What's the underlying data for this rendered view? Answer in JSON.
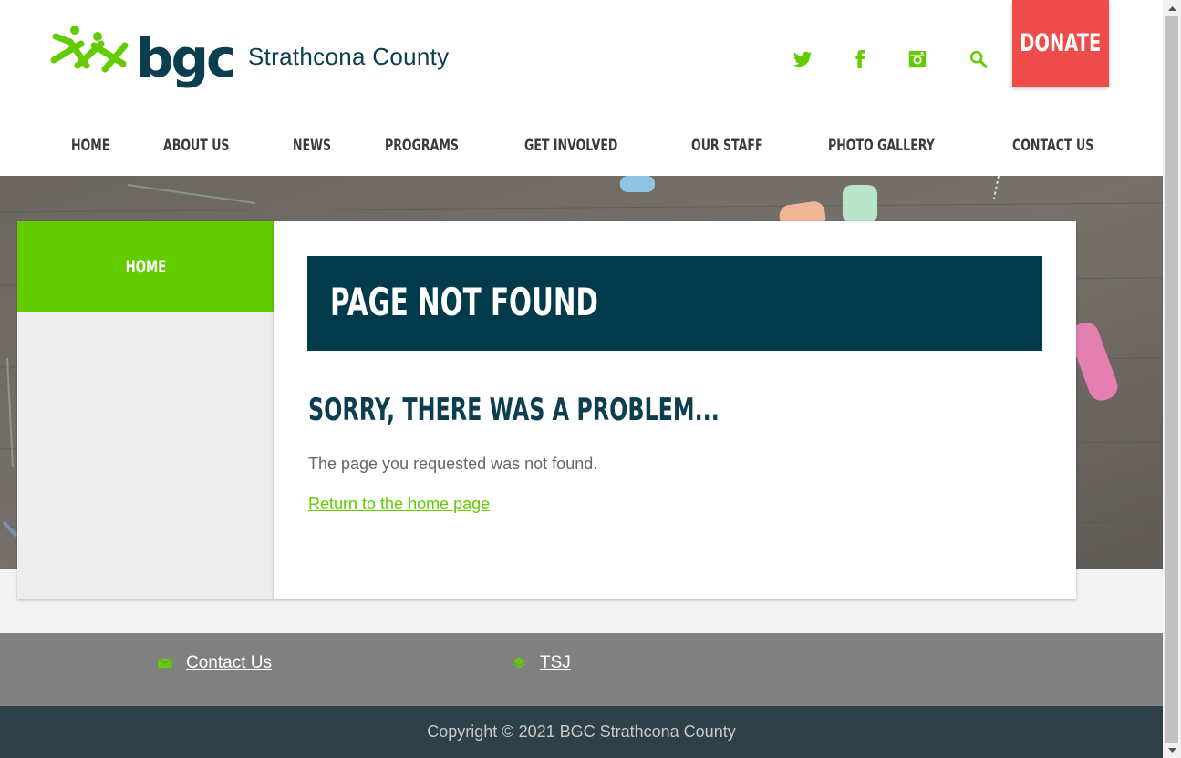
{
  "brand": {
    "logo_text": "bgc",
    "subtitle": "Strathcona County"
  },
  "header": {
    "social_icons": [
      "twitter-icon",
      "facebook-icon",
      "instagram-icon",
      "search-icon"
    ],
    "donate_label": "DONATE"
  },
  "nav": {
    "items": [
      {
        "label": "HOME"
      },
      {
        "label": "ABOUT US"
      },
      {
        "label": "NEWS"
      },
      {
        "label": "PROGRAMS"
      },
      {
        "label": "GET INVOLVED"
      },
      {
        "label": "OUR STAFF"
      },
      {
        "label": "PHOTO GALLERY"
      },
      {
        "label": "CONTACT US"
      }
    ]
  },
  "sidebar": {
    "home_label": "HOME"
  },
  "main": {
    "title": "PAGE NOT FOUND",
    "subheading": "SORRY, THERE WAS A PROBLEM...",
    "message": "The page you requested was not found.",
    "home_link": "Return to the home page"
  },
  "footer": {
    "links": [
      {
        "label": "Contact Us",
        "icon": "mail-icon"
      },
      {
        "label": "TSJ",
        "icon": "layers-icon"
      }
    ],
    "copyright": "Copyright © 2021 BGC Strathcona County"
  },
  "colors": {
    "brand_green": "#63cc00",
    "brand_navy": "#003a4b",
    "donate_red": "#ee4b4b",
    "footer_gray": "#808080",
    "footer_dark": "#2e4048"
  }
}
